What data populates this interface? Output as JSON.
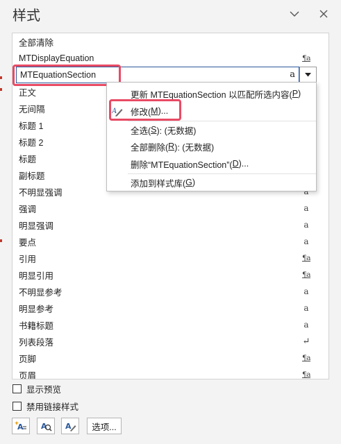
{
  "pane": {
    "title": "样式",
    "collapse_icon": "chevron-down-icon",
    "close_icon": "close-icon"
  },
  "styles": [
    {
      "name": "全部清除",
      "symbol": ""
    },
    {
      "name": "MTDisplayEquation",
      "symbol": "¶a"
    },
    {
      "name": "MTEquationSection",
      "symbol": "a"
    },
    {
      "name": "正文",
      "symbol": ""
    },
    {
      "name": "无间隔",
      "symbol": ""
    },
    {
      "name": "标题 1",
      "symbol": ""
    },
    {
      "name": "标题 2",
      "symbol": ""
    },
    {
      "name": "标题",
      "symbol": ""
    },
    {
      "name": "副标题",
      "symbol": ""
    },
    {
      "name": "不明显强调",
      "symbol": "a"
    },
    {
      "name": "强调",
      "symbol": "a"
    },
    {
      "name": "明显强调",
      "symbol": "a"
    },
    {
      "name": "要点",
      "symbol": "a"
    },
    {
      "name": "引用",
      "symbol": "¶a"
    },
    {
      "name": "明显引用",
      "symbol": "¶a"
    },
    {
      "name": "不明显参考",
      "symbol": "a"
    },
    {
      "name": "明显参考",
      "symbol": "a"
    },
    {
      "name": "书籍标题",
      "symbol": "a"
    },
    {
      "name": "列表段落",
      "symbol": "↵"
    },
    {
      "name": "页脚",
      "symbol": "¶a"
    },
    {
      "name": "页眉",
      "symbol": "¶a"
    }
  ],
  "editing": {
    "value": "MTEquationSection",
    "symbol": "a"
  },
  "context_menu": {
    "update": {
      "prefix": "更新 MTEquationSection 以匹配所选内容(",
      "key": "P",
      "suffix": ")"
    },
    "modify": {
      "prefix": "修改(",
      "key": "M",
      "suffix": ")..."
    },
    "select_all": {
      "prefix": "全选(",
      "key": "S",
      "suffix": "): (无数据)"
    },
    "remove_all": {
      "prefix": "全部删除(",
      "key": "R",
      "suffix": "): (无数据)"
    },
    "delete": {
      "prefix": "删除“MTEquationSection”(",
      "key": "D",
      "suffix": ")..."
    },
    "add_gallery": {
      "prefix": "添加到样式库(",
      "key": "G",
      "suffix": ")"
    }
  },
  "options": {
    "show_preview": "显示预览",
    "disable_linked": "禁用链接样式"
  },
  "toolbar": {
    "new_style_icon": "new-style-icon",
    "style_inspector_icon": "style-inspector-icon",
    "manage_styles_icon": "manage-styles-icon",
    "options_label": "选项..."
  },
  "colors": {
    "highlight": "#e94a64",
    "focus_border": "#2b579a"
  }
}
